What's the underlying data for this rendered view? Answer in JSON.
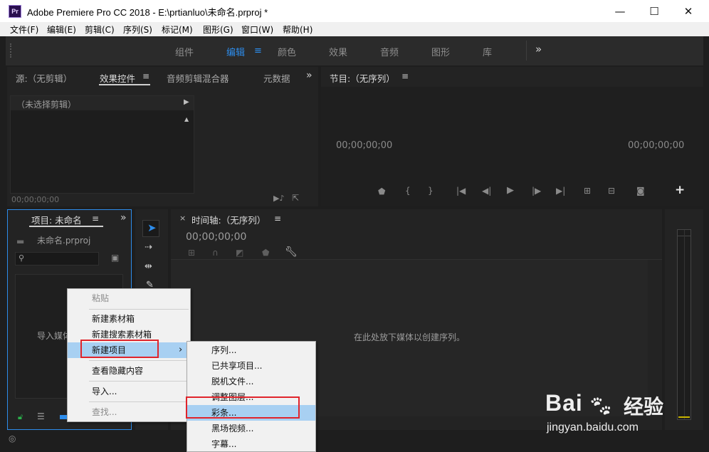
{
  "window": {
    "app_icon_text": "Pr",
    "title": "Adobe Premiere Pro CC 2018 - E:\\prtianluo\\未命名.prproj *",
    "minimize": "—",
    "maximize": "☐",
    "close": "✕"
  },
  "menubar": [
    "文件(F)",
    "编辑(E)",
    "剪辑(C)",
    "序列(S)",
    "标记(M)",
    "图形(G)",
    "窗口(W)",
    "帮助(H)"
  ],
  "workspaces": {
    "items": [
      "组件",
      "编辑",
      "颜色",
      "效果",
      "音频",
      "图形",
      "库"
    ],
    "active": "编辑",
    "more": "»"
  },
  "source_panel": {
    "tabs": [
      "源:（无剪辑）",
      "效果控件",
      "音频剪辑混合器",
      "元数据"
    ],
    "active_tab": "效果控件",
    "more": "»",
    "no_clip": "（未选择剪辑）",
    "timecode": "00;00;00;00"
  },
  "program_panel": {
    "title": "节目:（无序列）",
    "timecode_left": "00;00;00;00",
    "timecode_right": "00;00;00;00",
    "add_button": "+"
  },
  "project_panel": {
    "tab": "项目: 未命名",
    "more": "»",
    "project_file": "未命名.prproj",
    "search_placeholder": "",
    "import_hint": "导入媒体"
  },
  "timeline_panel": {
    "close": "×",
    "title": "时间轴:（无序列）",
    "timecode": "00;00;00;00",
    "drop_hint": "在此处放下媒体以创建序列。"
  },
  "context_menu": {
    "items": [
      "粘贴",
      "新建素材箱",
      "新建搜索素材箱",
      "新建项目",
      "查看隐藏内容",
      "导入...",
      "查找..."
    ],
    "disabled": [
      "粘贴",
      "查找..."
    ],
    "highlighted": "新建项目",
    "arrow": "›"
  },
  "submenu": {
    "items": [
      "序列...",
      "已共享项目...",
      "脱机文件...",
      "调整图层...",
      "彩条...",
      "黑场视频...",
      "字幕..."
    ],
    "highlighted": "彩条..."
  },
  "watermark": {
    "brand": "Bai",
    "brand_suffix": "经验",
    "url": "jingyan.baidu.com"
  },
  "colors": {
    "accent": "#2d8ceb",
    "highlight": "#a8d0f2",
    "annotation": "#e0242b"
  }
}
